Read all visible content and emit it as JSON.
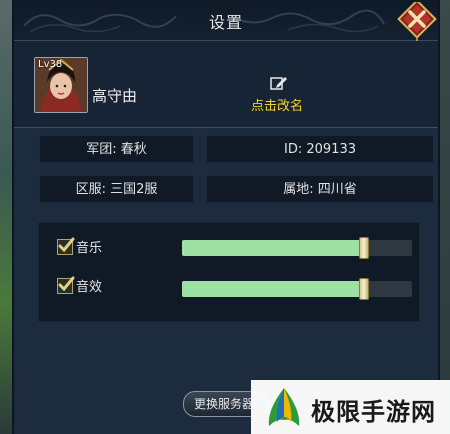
{
  "window": {
    "title": "设置"
  },
  "profile": {
    "level": "Lv38",
    "name": "高守由",
    "rename_label": "点击改名"
  },
  "info": {
    "legion": "军团: 春秋",
    "id": "ID: 209133",
    "server": "区服: 三国2服",
    "location": "属地: 四川省"
  },
  "sound": {
    "music_label": "音乐",
    "music_enabled": true,
    "music_volume": 0.79,
    "sfx_label": "音效",
    "sfx_enabled": true,
    "sfx_volume": 0.79
  },
  "buttons": {
    "switch_server": "更换服务器"
  },
  "watermark": {
    "text": "极限手游网"
  },
  "colors": {
    "accent_gold": "#f2d32a",
    "slider_fill": "#9fe0a4",
    "close_red": "#c0392b"
  },
  "icons": {
    "close": "close-x-icon",
    "rename": "edit-pencil-icon",
    "check": "checkmark-icon"
  }
}
